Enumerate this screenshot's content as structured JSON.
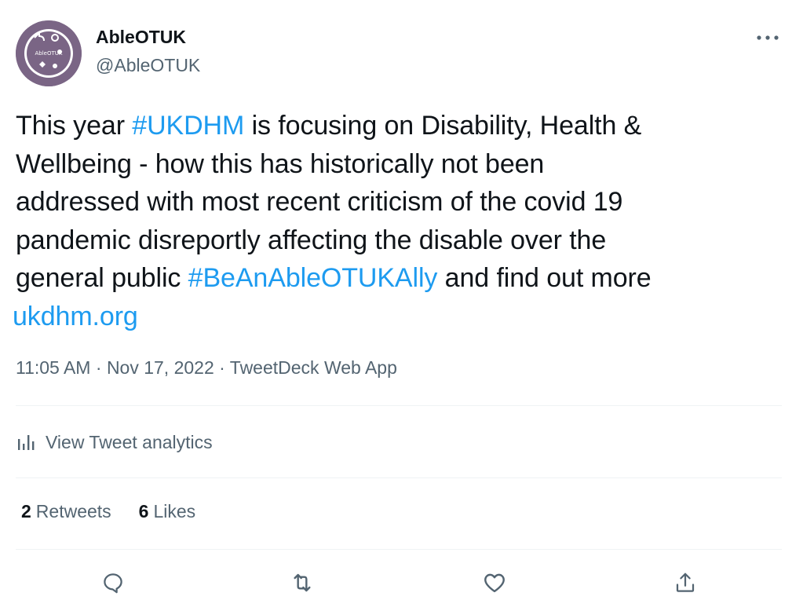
{
  "author": {
    "display_name": "AbleOTUK",
    "handle": "@AbleOTUK"
  },
  "tweet": {
    "lines": [
      {
        "parts": [
          {
            "text": "This year ",
            "link": false
          },
          {
            "text": "#UKDHM",
            "link": true
          },
          {
            "text": " is focusing on Disability, Health &",
            "link": false
          }
        ]
      },
      {
        "parts": [
          {
            "text": "Wellbeing - how this has historically not been",
            "link": false
          }
        ]
      },
      {
        "parts": [
          {
            "text": "addressed with most recent criticism of the covid 19",
            "link": false
          }
        ]
      },
      {
        "parts": [
          {
            "text": "pandemic disreportly affecting the disable over the",
            "link": false
          }
        ]
      },
      {
        "parts": [
          {
            "text": "general public ",
            "link": false
          },
          {
            "text": "#BeAnAbleOTUKAlly",
            "link": true
          },
          {
            "text": " and find out more",
            "link": false
          }
        ]
      }
    ],
    "url": "ukdhm.org"
  },
  "meta": {
    "time": "11:05 AM",
    "separator": " · ",
    "date": "Nov 17, 2022",
    "source": "TweetDeck Web App"
  },
  "analytics": {
    "label": "View Tweet analytics"
  },
  "stats": {
    "retweets_count": "2",
    "retweets_label": "Retweets",
    "likes_count": "6",
    "likes_label": "Likes"
  },
  "colors": {
    "link": "#1d9bf0",
    "text": "#0f1419",
    "secondary": "#536471",
    "divider": "#eff3f4",
    "avatar_bg": "#7a6585"
  },
  "icons": {
    "more": "more-horizontal-icon",
    "analytics": "bar-chart-icon",
    "reply": "reply-bubble-icon",
    "retweet": "retweet-arrows-icon",
    "like": "heart-icon",
    "share": "share-upload-icon"
  }
}
